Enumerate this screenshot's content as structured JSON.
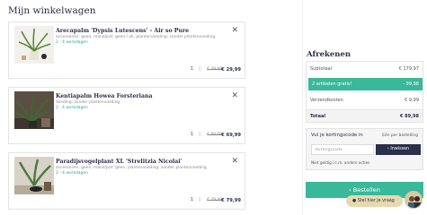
{
  "cart": {
    "title": "Mijn winkelwagen",
    "items": [
      {
        "name": "Arecapalm 'Dypsis Lutescens' - Air so Pure",
        "desc": "accessoires: geen, mand/pot: geen / ok, plantenvoeding: zonder plantenvoeding",
        "lead": "2 - 4 werkdagen",
        "qty": "1",
        "old_price": "€ 39,99",
        "price": "€ 29,99",
        "thumb_icon": "areca-palm-photo"
      },
      {
        "name": "Kentiapalm Howea Forsteriana",
        "desc": "Voeding: zonder plantenvoeding",
        "lead": "2 - 4 werkdagen",
        "qty": "1",
        "old_price": "€ 89,99",
        "price": "€ 69,99",
        "thumb_icon": "kentia-palm-photo"
      },
      {
        "name": "Paradijsvogelplant XL 'Strelitzia Nicolai'",
        "desc": "accessoires: geen, mand/pot: geen, plantenvoeding: zonder plantenvoeding",
        "lead": "2 - 4 werkdagen",
        "qty": "1",
        "old_price": "€ 79,99",
        "price": "€ 79,99",
        "thumb_icon": "strelitzia-photo"
      }
    ],
    "remove_glyph": "✕",
    "qty_divider": "||"
  },
  "checkout": {
    "title": "Afrekenen",
    "subtotal_label": "Subtotaal",
    "subtotal_value": "€ 179,97",
    "discount_label": "2 artikelen gratis!",
    "discount_value": "- 99,98",
    "shipping_label": "Verzendkosten",
    "shipping_value": "€ 9,99",
    "total_label": "Totaal",
    "total_value": "€ 89,98"
  },
  "coupon": {
    "label": "Vul je kortingscode in",
    "note": "Eén per bestelling",
    "placeholder": "Kortingscode",
    "button": "› Inwissen",
    "hint": "Niet geldig i.c.m. andere acties"
  },
  "order_button": "› Bestellen",
  "chat": {
    "label": "● Stel hier je vraag"
  },
  "colors": {
    "accent": "#3ab89a",
    "navy": "#2b2f4a",
    "chat": "#e8d8b0"
  }
}
